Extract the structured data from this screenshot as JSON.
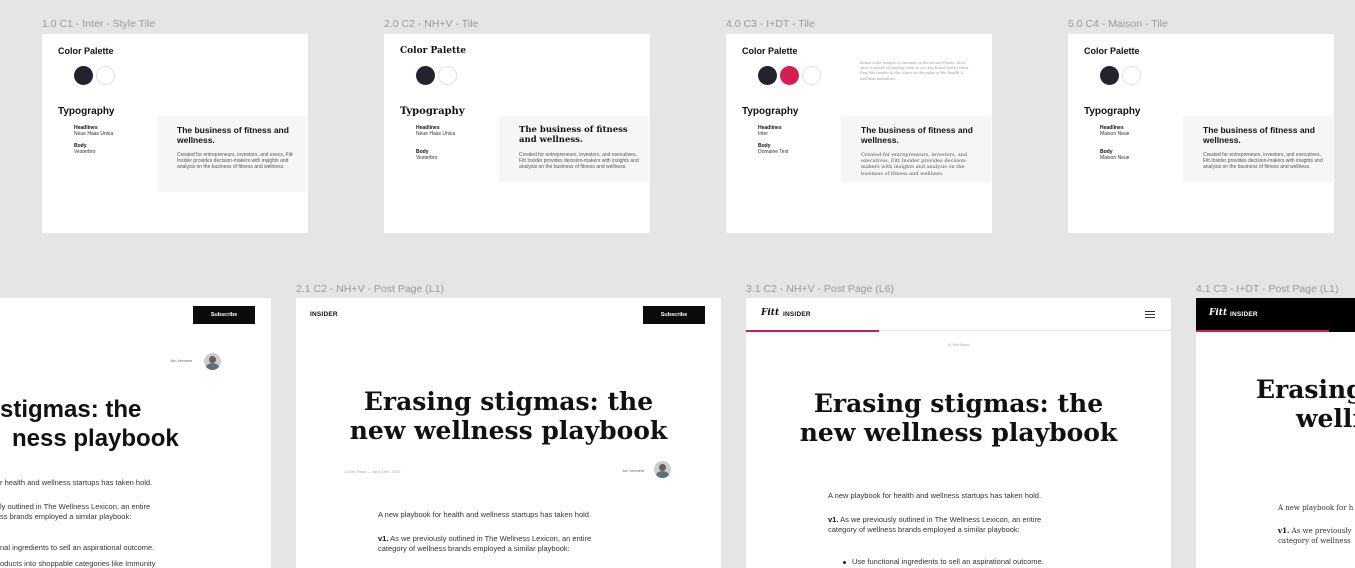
{
  "frames": {
    "tile1_label": "1.0 C1 - Inter - Style Tile",
    "tile2_label": "2.0 C2 - NH+V - Tile",
    "tile3_label": "4.0 C3 - I+DT - Tile",
    "tile4_label": "5.0 C4 - Maison - Tile",
    "page2_label": "2.1 C2 - NH+V - Post Page (L1)",
    "page3_label": "3.1 C2 - NH+V - Post Page (L6)",
    "page4_label": "4.1 C3 - I+DT - Post Page (L1)"
  },
  "tiles": {
    "color_palette": "Color Palette",
    "typography": "Typography",
    "headlines": "Headlines",
    "body": "Body",
    "tile1": {
      "headline_font": "Neue Haas Unica",
      "body_font": "Vesterbro",
      "sample_head": "The business of fitness and wellness.",
      "sample_body": "Created for entrepreneurs, investors, and execs, Fitt Insider provides decision-makers with insights and analysis on the business of fitness and wellness."
    },
    "tile2": {
      "headline_font": "Neue Haas Unica",
      "body_font": "Vesterbro",
      "sample_head": "The business of fitness and wellness.",
      "sample_body": "Created for entrepreneurs, investors, and executives, Fitt Insider provides decision-makers with insights and analysis on the business of fitness and wellness."
    },
    "tile3": {
      "headline_font": "Inter",
      "body_font": "Domaine Text",
      "sample_head": "The business of fitness and wellness.",
      "sample_body": "Created for entrepreneurs, investors, and executives, Fitt Insider provides decision-makers with insights and analysis on the business of fitness and wellness.",
      "note": "Bonus color sample & rationale is the accent theme: then stick a splash of reading color is our key brand red to show that Fitt Insider is the closer to the pulse of the health & wellness industries."
    },
    "tile4": {
      "headline_font": "Maison Neue",
      "body_font": "Maison Neue",
      "sample_head": "The business of fitness and wellness.",
      "sample_body": "Created for entrepreneurs, investors, and executives, Fitt Insider provides decision-makers with insights and analysis on the business of fitness and wellness."
    }
  },
  "post": {
    "subscribe": "Subscribe",
    "insider": "INSIDER",
    "fitt": "Fitt",
    "author": "Jon Vennem",
    "title_line1": "Erasing stigmas: the",
    "title_line2": "new wellness playbook",
    "partial_title_line1": "stigmas: the",
    "partial_title_line2": "ness playbook",
    "p4_title_line1": "Erasing s",
    "p4_title_line2": "welln",
    "meta": "11 Min Read — April 19th, 2020",
    "read_time": "11 Min Read",
    "para1": "A new playbook for health and wellness startups has taken hold.",
    "para2_bold": "v1.",
    "para2_line1": " As we previously outlined in The Wellness Lexicon, an entire",
    "para2_line2": "category of wellness brands employed a similar playbook:",
    "bullet1": "Use functional ingredients to sell an aspirational outcome.",
    "partial_para1": "r health and wellness startups has taken hold.",
    "partial_para2_l1": "ly outlined in The Wellness Lexicon, an entire",
    "partial_para2_l2": "ss brands employed a similar playbook:",
    "partial_b1": "nal ingredients to sell an aspirational outcome.",
    "partial_b2": "oducts into shoppable categories like Immunity",
    "p4_para1": "A new playbook for h",
    "p4_para2_l1": " As we previously",
    "p4_para2_l2": "category of wellness"
  }
}
